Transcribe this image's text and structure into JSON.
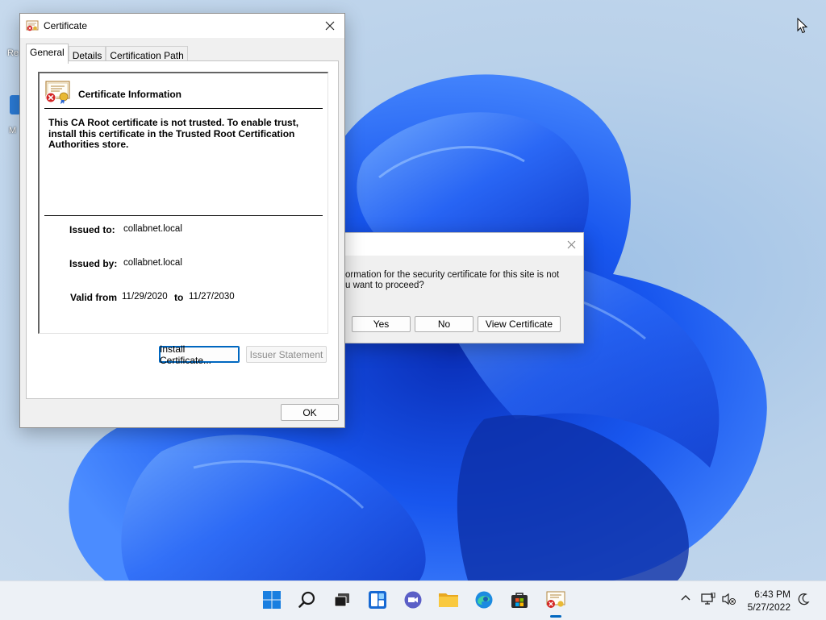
{
  "desktop": {
    "icon1_label": "Re",
    "icon2_label": "M"
  },
  "cert_dialog": {
    "title": "Certificate",
    "tabs": [
      {
        "label": "General"
      },
      {
        "label": "Details"
      },
      {
        "label": "Certification Path"
      }
    ],
    "info_title": "Certificate Information",
    "warning": "This CA Root certificate is not trusted. To enable trust, install this certificate in the Trusted Root Certification Authorities store.",
    "issued_to_label": "Issued to:",
    "issued_to_value": "collabnet.local",
    "issued_by_label": "Issued by:",
    "issued_by_value": "collabnet.local",
    "valid_from_label": "Valid from",
    "valid_from_value": "11/29/2020",
    "valid_to_label": "to",
    "valid_to_value": "11/27/2030",
    "install_button": "Install Certificate...",
    "issuer_button": "Issuer Statement",
    "ok_button": "OK"
  },
  "security_alert": {
    "message_line1": "ormation for the security certificate for this site is not",
    "message_line2": "u want to proceed?",
    "yes_button": "Yes",
    "no_button": "No",
    "view_button": "View Certificate"
  },
  "taskbar": {
    "icons": [
      "start-icon",
      "search-icon",
      "task-view-icon",
      "widgets-icon",
      "chat-icon",
      "file-explorer-icon",
      "edge-icon",
      "store-icon",
      "certificate-app-icon"
    ],
    "time": "6:43 PM",
    "date": "5/27/2022"
  },
  "colors": {
    "accent": "#0067c0",
    "wallpaper_bloom": "#1a5cf0"
  }
}
